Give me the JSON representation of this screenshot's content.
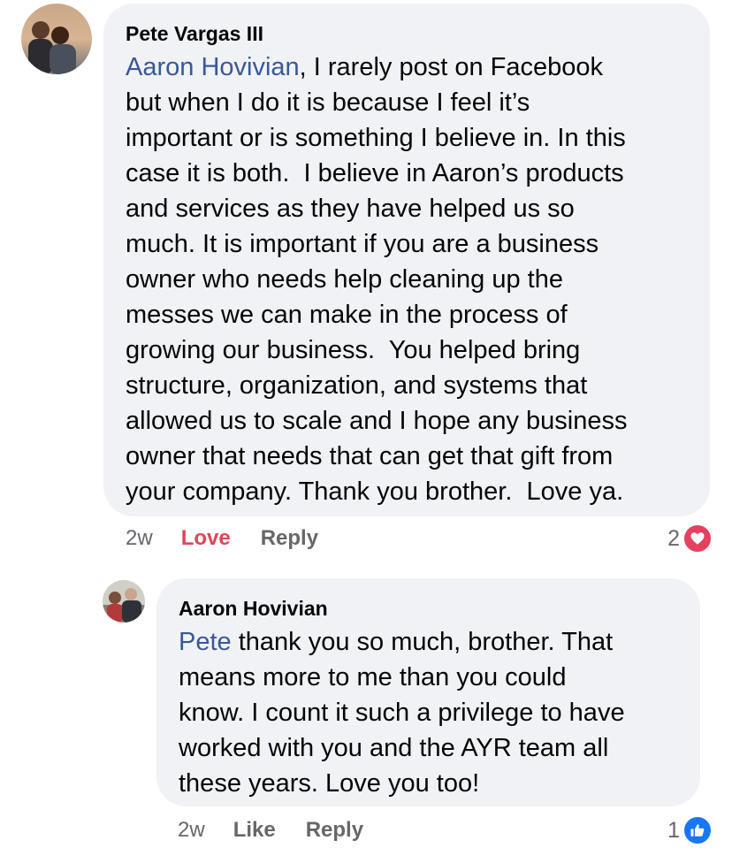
{
  "comment1": {
    "author": "Pete Vargas III",
    "mention": "Aaron Hovivian",
    "lines": [
      ", I rarely post on Facebook",
      "but when I do it is because I feel it’s",
      "important or is something I believe in. In this",
      "case it is both.  I believe in Aaron’s products",
      "and services as they have helped us so",
      "much. It is important if you are a business",
      "owner who needs help cleaning up the",
      "messes we can make in the process of",
      "growing our business.  You helped bring",
      "structure, organization, and systems that",
      "allowed us to scale and I hope any business",
      "owner that needs that can get that gift from",
      "your company. Thank you brother.  Love ya."
    ],
    "time": "2w",
    "love_label": "Love",
    "reply_label": "Reply",
    "reaction_count": "2",
    "reaction_icon": "heart-icon",
    "reaction_color": "#e4405f"
  },
  "comment2": {
    "author": "Aaron Hovivian",
    "mention": "Pete",
    "lines": [
      " thank you so much, brother. That",
      "means more to me than you could",
      "know. I count it such a privilege to have",
      "worked with you and the AYR team all",
      "these years. Love you too!"
    ],
    "time": "2w",
    "like_label": "Like",
    "reply_label": "Reply",
    "reaction_count": "1",
    "reaction_icon": "thumbs-up-icon",
    "reaction_color": "#1877f2"
  }
}
